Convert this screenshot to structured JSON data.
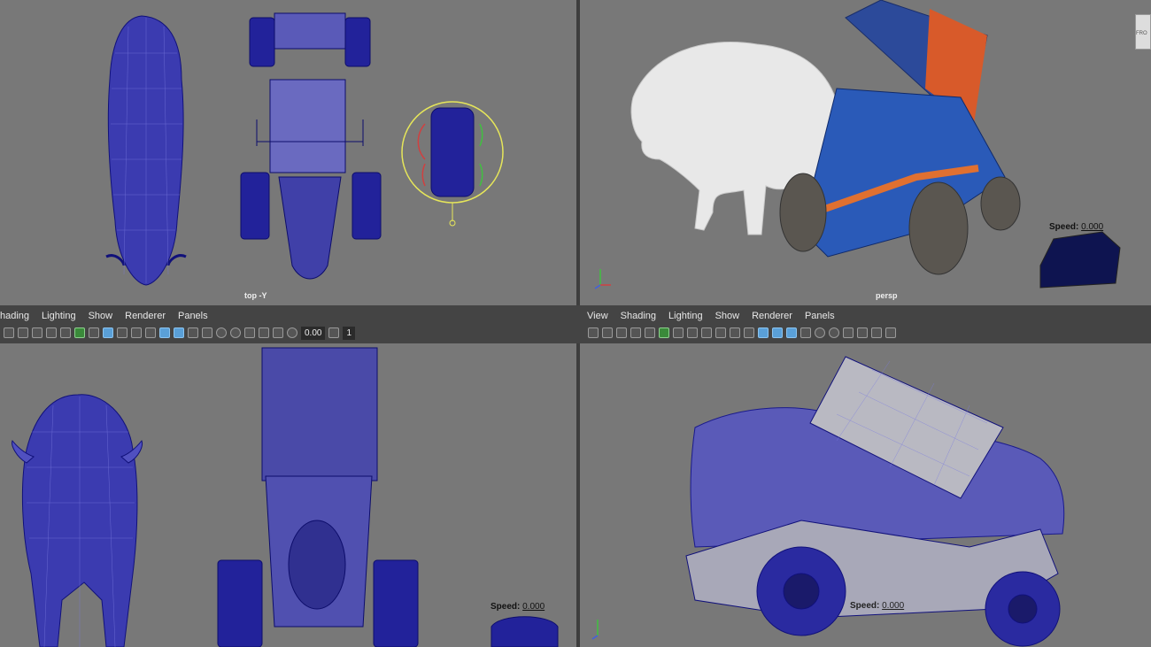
{
  "viewports": {
    "top_left": {
      "label": "top -Y"
    },
    "top_right": {
      "label": "persp",
      "speed_label": "Speed:",
      "speed_value": "0.000",
      "view_cube_text": "FRO"
    },
    "bottom_left": {
      "speed_label": "Speed:",
      "speed_value": "0.000"
    },
    "bottom_right": {
      "speed_label": "Speed:",
      "speed_value": "0.000"
    }
  },
  "panel_menu_left": [
    "hading",
    "Lighting",
    "Show",
    "Renderer",
    "Panels"
  ],
  "panel_menu_right": [
    "View",
    "Shading",
    "Lighting",
    "Show",
    "Renderer",
    "Panels"
  ],
  "toolbar_left": {
    "field_value": "0.00",
    "field_value_2": "1"
  },
  "colors": {
    "viewport_bg": "#787878",
    "wire": "#1a1a8c",
    "selection": "#e6e65a",
    "toolbar_bg": "#444444"
  }
}
